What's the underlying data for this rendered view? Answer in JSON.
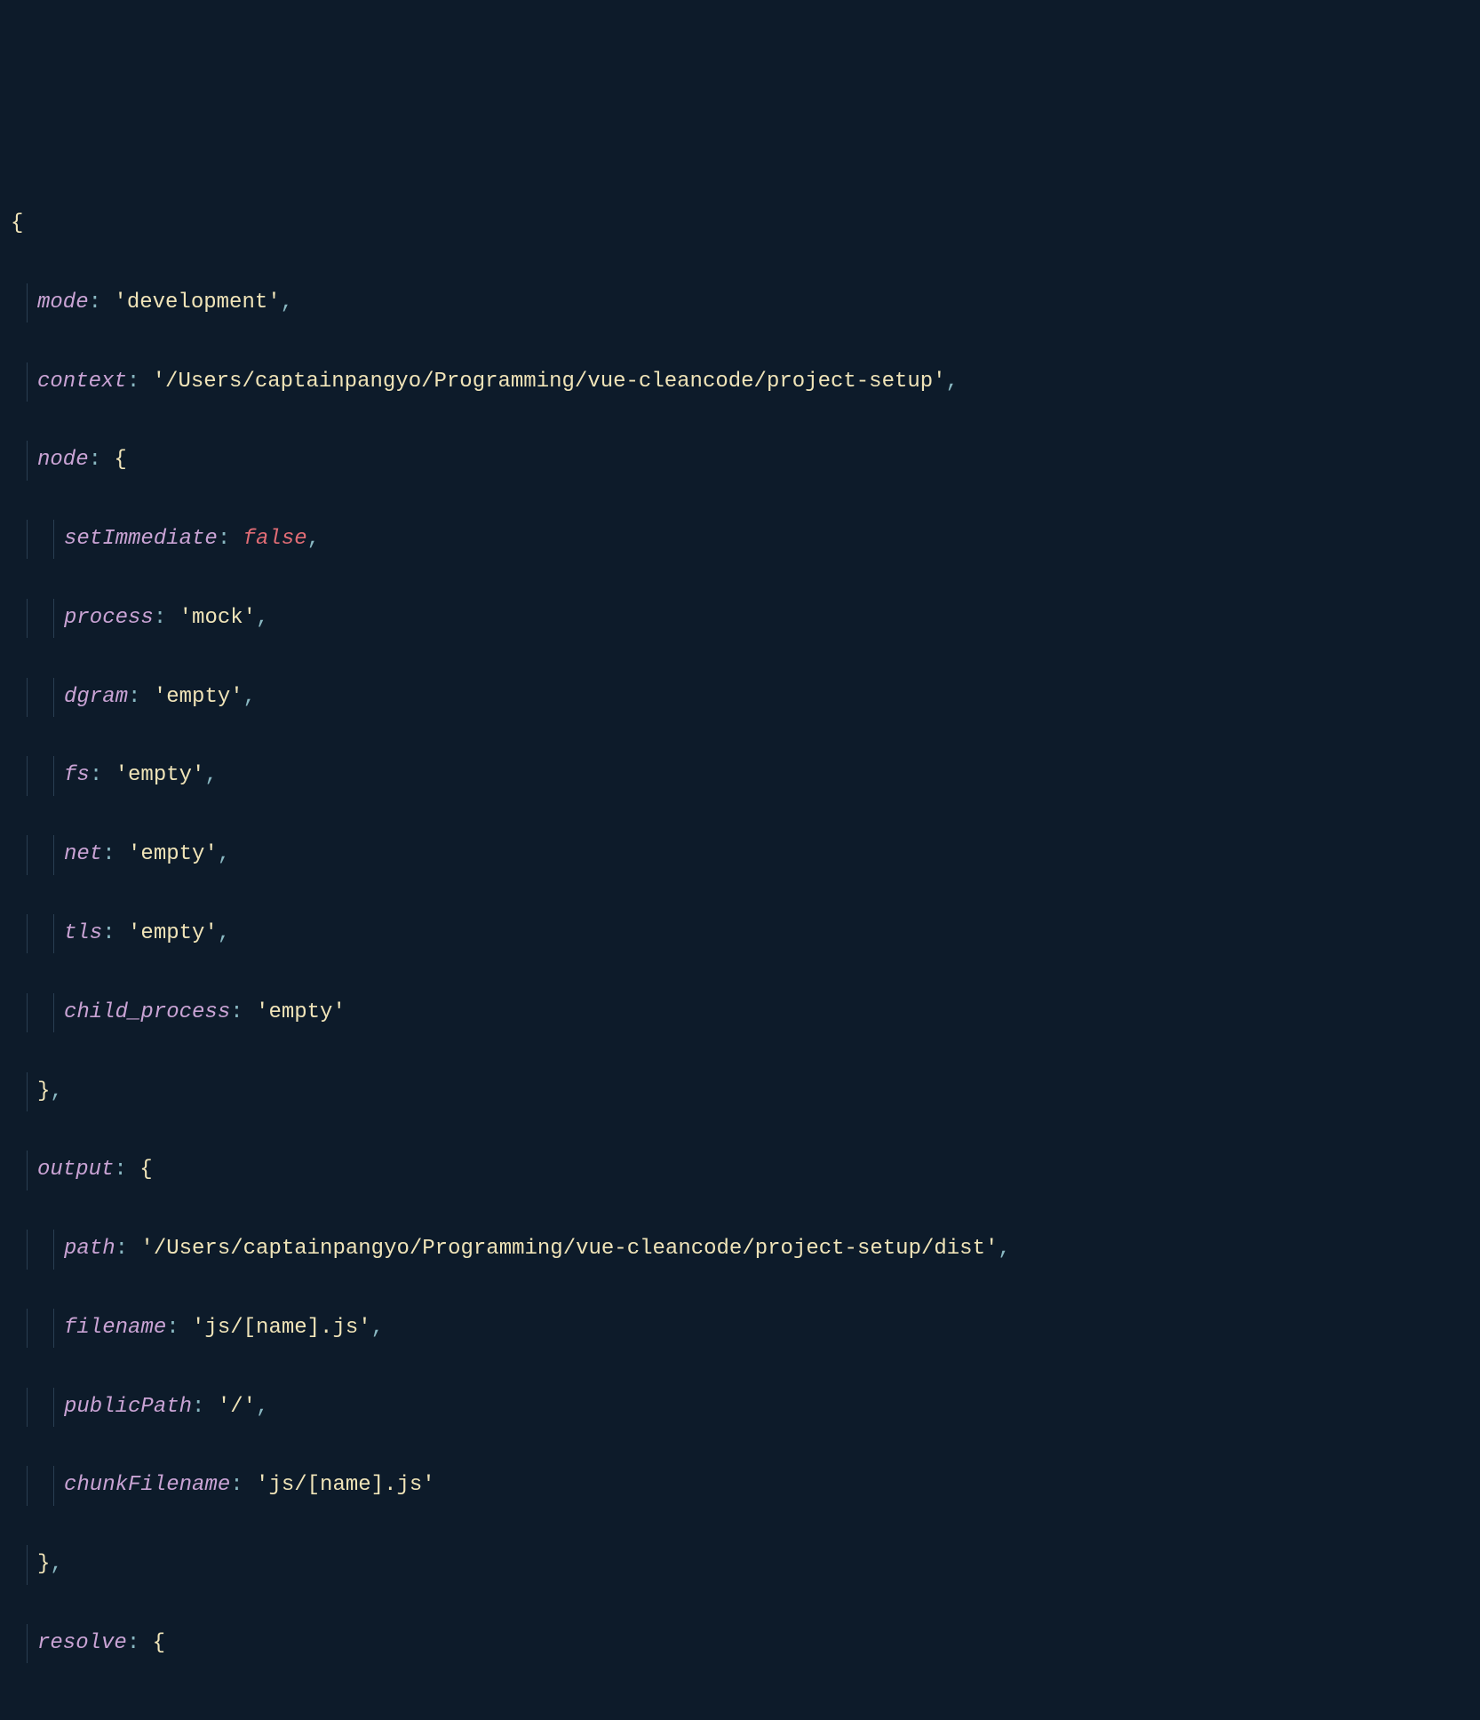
{
  "code": {
    "l1": "{",
    "l2_key": "mode",
    "l2_val": "'development'",
    "l3_key": "context",
    "l3_val": "'/Users/captainpangyo/Programming/vue-cleancode/project-setup'",
    "l4_key": "node",
    "l4_brace": "{",
    "l5_key": "setImmediate",
    "l5_val": "false",
    "l6_key": "process",
    "l6_val": "'mock'",
    "l7_key": "dgram",
    "l7_val": "'empty'",
    "l8_key": "fs",
    "l8_val": "'empty'",
    "l9_key": "net",
    "l9_val": "'empty'",
    "l10_key": "tls",
    "l10_val": "'empty'",
    "l11_key": "child_process",
    "l11_val": "'empty'",
    "l12": "}",
    "l13_key": "output",
    "l13_brace": "{",
    "l14_key": "path",
    "l14_val": "'/Users/captainpangyo/Programming/vue-cleancode/project-setup/dist'",
    "l15_key": "filename",
    "l15_val": "'js/[name].js'",
    "l16_key": "publicPath",
    "l16_val": "'/'",
    "l17_key": "chunkFilename",
    "l17_val": "'js/[name].js'",
    "l18": "}",
    "l19_key": "resolve",
    "l19_brace": "{",
    "colon": ":",
    "comma": ","
  }
}
